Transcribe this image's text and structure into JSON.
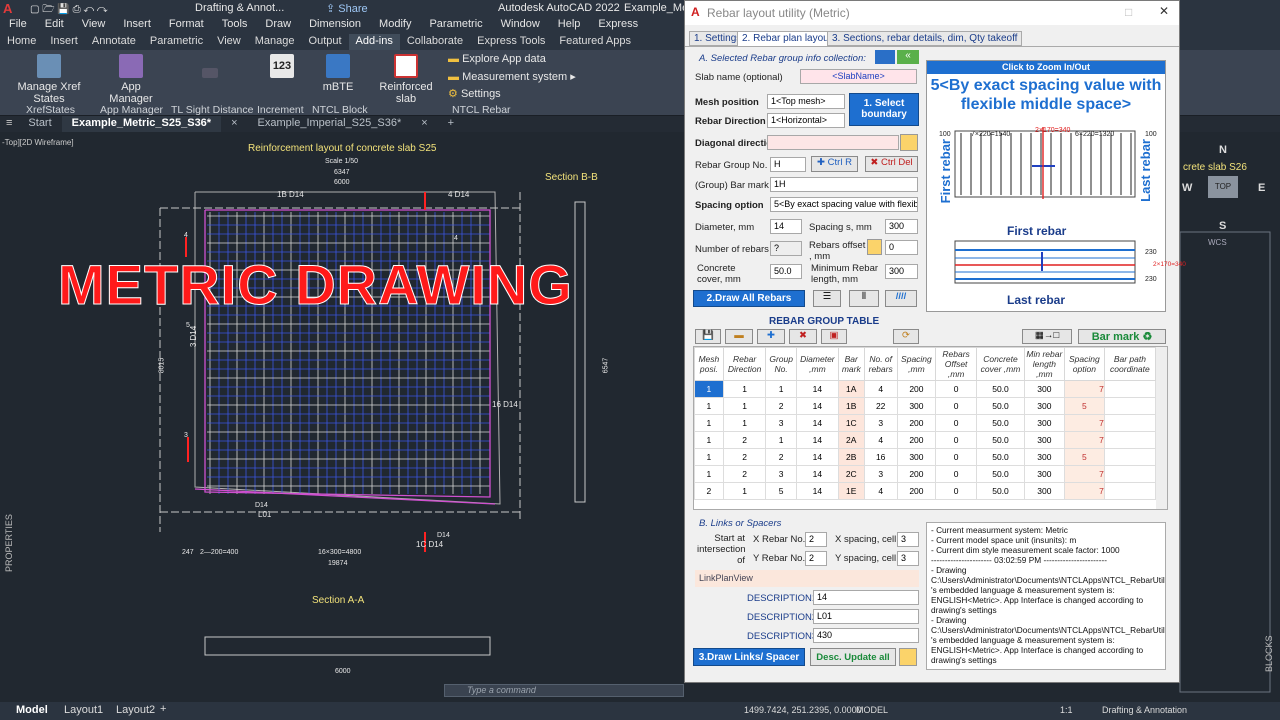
{
  "app": {
    "title": "Autodesk AutoCAD 2022",
    "file_title": "Example_Met",
    "workspace": "Drafting & Annot...",
    "share": "Share",
    "logo": "A"
  },
  "menu": [
    "File",
    "Edit",
    "View",
    "Insert",
    "Format",
    "Tools",
    "Draw",
    "Dimension",
    "Modify",
    "Parametric",
    "Window",
    "Help",
    "Express"
  ],
  "ribbon_tabs": [
    "Home",
    "Insert",
    "Annotate",
    "Parametric",
    "View",
    "Manage",
    "Output",
    "Add-ins",
    "Collaborate",
    "Express Tools",
    "Featured Apps"
  ],
  "ribbon_active": "Add-ins",
  "ribbon": {
    "manage_xref": "Manage Xref States",
    "app_manager": "App Manager",
    "mbte": "mBTE",
    "reinforced": "Reinforced slab",
    "explore": "Explore App data",
    "measurement": "Measurement system",
    "settings": "Settings",
    "panel_xref": "XrefStates",
    "panel_app": "App Manager",
    "panel_tl": "TL Sight Distance",
    "panel_incr": "Increment",
    "panel_ntcl": "NTCL Block",
    "panel_ntcl_rebar": "NTCL Rebar",
    "incr_icon": "123"
  },
  "doc_tabs": [
    "Start",
    "Example_Metric_S25_S36*",
    "Example_Imperial_S25_S36*"
  ],
  "viewport_label": "-Top][2D Wireframe]",
  "drawing": {
    "title": "Reinforcement layout of concrete slab S25",
    "scale": "Scale 1/50",
    "section_b": "Section B-B",
    "section_a": "Section A-A",
    "overlay": "METRIC DRAWING",
    "slab_s26": "crete slab S26",
    "dims": {
      "top1": "6347",
      "top2": "6000",
      "bottom": "16×300=4800",
      "left": "8015",
      "right": "6547",
      "bottom2": "247",
      "bottom3": "2—200=400",
      "bottom4": "19874",
      "bottom5": "6000",
      "sec_dim": "6000"
    },
    "rebar_labels": {
      "b1": "1B D14",
      "b4": "4 D14",
      "b3": "3 D14",
      "b16": "16 D14",
      "l01": "L01",
      "c1": "1C D14",
      "d14": "D14",
      "d14b": "D14",
      "m4": "4",
      "m3": "3",
      "m4b": "4",
      "m5": "5"
    }
  },
  "viewcube": {
    "n": "N",
    "s": "S",
    "w": "W",
    "e": "E",
    "top": "TOP",
    "wcs": "WCS"
  },
  "command_placeholder": "Type a command",
  "status": {
    "model": "Model",
    "layout1": "Layout1",
    "layout2": "Layout2",
    "coords": "1499.7424, 251.2395, 0.0000",
    "mode": "MODEL",
    "workspace": "Drafting & Annotation",
    "scale": "1:1"
  },
  "side_labels": {
    "properties": "PROPERTIES",
    "blocks": "BLOCKS"
  },
  "dialog": {
    "title": "Rebar layout utility (Metric)",
    "tabs": [
      "1. Settings",
      "2. Rebar plan layout",
      "3. Sections, rebar details, dim, Qty takeoff"
    ],
    "section_a": "A. Selected Rebar group info collection:",
    "slab_name_label": "Slab name (optional)",
    "slab_name": "<SlabName>",
    "mesh_position_label": "Mesh position",
    "mesh_position": "1<Top mesh>",
    "rebar_direction_label": "Rebar Direction",
    "rebar_direction": "1<Horizontal>",
    "select_boundary": "1. Select boundary",
    "diagonal_label": "Diagonal direction",
    "group_no_label": "Rebar Group No.",
    "group_no": "H",
    "ctrl_r": "Ctrl R",
    "ctrl_del": "Ctrl Del",
    "bar_mark_label": "(Group) Bar mark",
    "bar_mark": "1H",
    "spacing_option_label": "Spacing option",
    "spacing_option": "5<By exact spacing value with flexible",
    "diameter_label": "Diameter, mm",
    "diameter": "14",
    "spacing_label": "Spacing  s, mm",
    "spacing": "300",
    "num_rebars_label": "Number of rebars",
    "num_rebars": "?",
    "offset_label": "Rebars offset , mm",
    "offset": "0",
    "cover_label": "Concrete cover, mm",
    "cover": "50.0",
    "min_len_label": "Minimum Rebar length, mm",
    "min_len": "300",
    "draw_all": "2.Draw All Rebars",
    "zoom": "Click to Zoom In/Out",
    "preview_title": "5<By exact spacing value with flexible middle space>",
    "first_rebar": "First rebar",
    "last_rebar": "Last rebar",
    "prev_dims": {
      "a": "7×220=1540",
      "b": "2×170=340",
      "c": "6×220=1320",
      "d": "100",
      "e": "100",
      "f": "230",
      "g": "230",
      "h": "2×170=340"
    },
    "group_table": "REBAR GROUP TABLE",
    "bar_mark_btn": "Bar mark",
    "columns": [
      "Mesh posi.",
      "Rebar Direction",
      "Group No.",
      "Diameter ,mm",
      "Bar mark",
      "No. of rebars",
      "Spacing ,mm",
      "Rebars Offset ,mm",
      "Concrete cover ,mm",
      "Min rebar length ,mm",
      "Spacing option",
      "Bar path coordinate"
    ],
    "rows": [
      [
        "1",
        "1",
        "1",
        "14",
        "1A",
        "4",
        "200",
        "0",
        "50.0",
        "300",
        "7",
        ""
      ],
      [
        "1",
        "1",
        "2",
        "14",
        "1B",
        "22",
        "300",
        "0",
        "50.0",
        "300",
        "5",
        ""
      ],
      [
        "1",
        "1",
        "3",
        "14",
        "1C",
        "3",
        "200",
        "0",
        "50.0",
        "300",
        "7",
        ""
      ],
      [
        "1",
        "2",
        "1",
        "14",
        "2A",
        "4",
        "200",
        "0",
        "50.0",
        "300",
        "7",
        ""
      ],
      [
        "1",
        "2",
        "2",
        "14",
        "2B",
        "16",
        "300",
        "0",
        "50.0",
        "300",
        "5",
        ""
      ],
      [
        "1",
        "2",
        "3",
        "14",
        "2C",
        "3",
        "200",
        "0",
        "50.0",
        "300",
        "7",
        ""
      ],
      [
        "2",
        "1",
        "5",
        "14",
        "1E",
        "4",
        "200",
        "0",
        "50.0",
        "300",
        "7",
        ""
      ]
    ],
    "section_b": "B. Links or Spacers",
    "start_label": "Start at intersection of",
    "x_rebar_label": "X Rebar No.",
    "x_rebar": "2",
    "y_rebar_label": "Y Rebar No.",
    "y_rebar": "2",
    "x_spacing_label": "X spacing, cell",
    "x_spacing": "3",
    "y_spacing_label": "Y spacing, cell",
    "y_spacing": "3",
    "link_plan": "LinkPlanView",
    "desc1_label": "DESCRIPTION1",
    "desc1": "14",
    "desc2_label": "DESCRIPTION2",
    "desc2": "L01",
    "desc3_label": "DESCRIPTION3",
    "desc3": "430",
    "draw_links": "3.Draw  Links/ Spacer",
    "desc_update": "Desc. Update all",
    "log": [
      "- Current measurment system: Metric",
      "- Current model space unit (insunits): m",
      "- Current dim style measurement scale factor: 1000",
      "---------------------- 03:02:59 PM -----------------------",
      "- Drawing C:\\Users\\Administrator\\Documents\\NTCLApps\\NTCL_RebarUtility.Bundle\\Contents\\Example_Metric_S25_S36.dwg 's embedded language & measurement system is:  ENGLISH<Metric>.  App Interface is changed according to drawing's settings",
      "- Drawing C:\\Users\\Administrator\\Documents\\NTCLApps\\NTCL_RebarUtility.Bundle\\Contents\\Example_Metric_S25_S36.dwg 's embedded language & measurement system is:  ENGLISH<Metric>.  App Interface is changed according to drawing's settings"
    ]
  }
}
